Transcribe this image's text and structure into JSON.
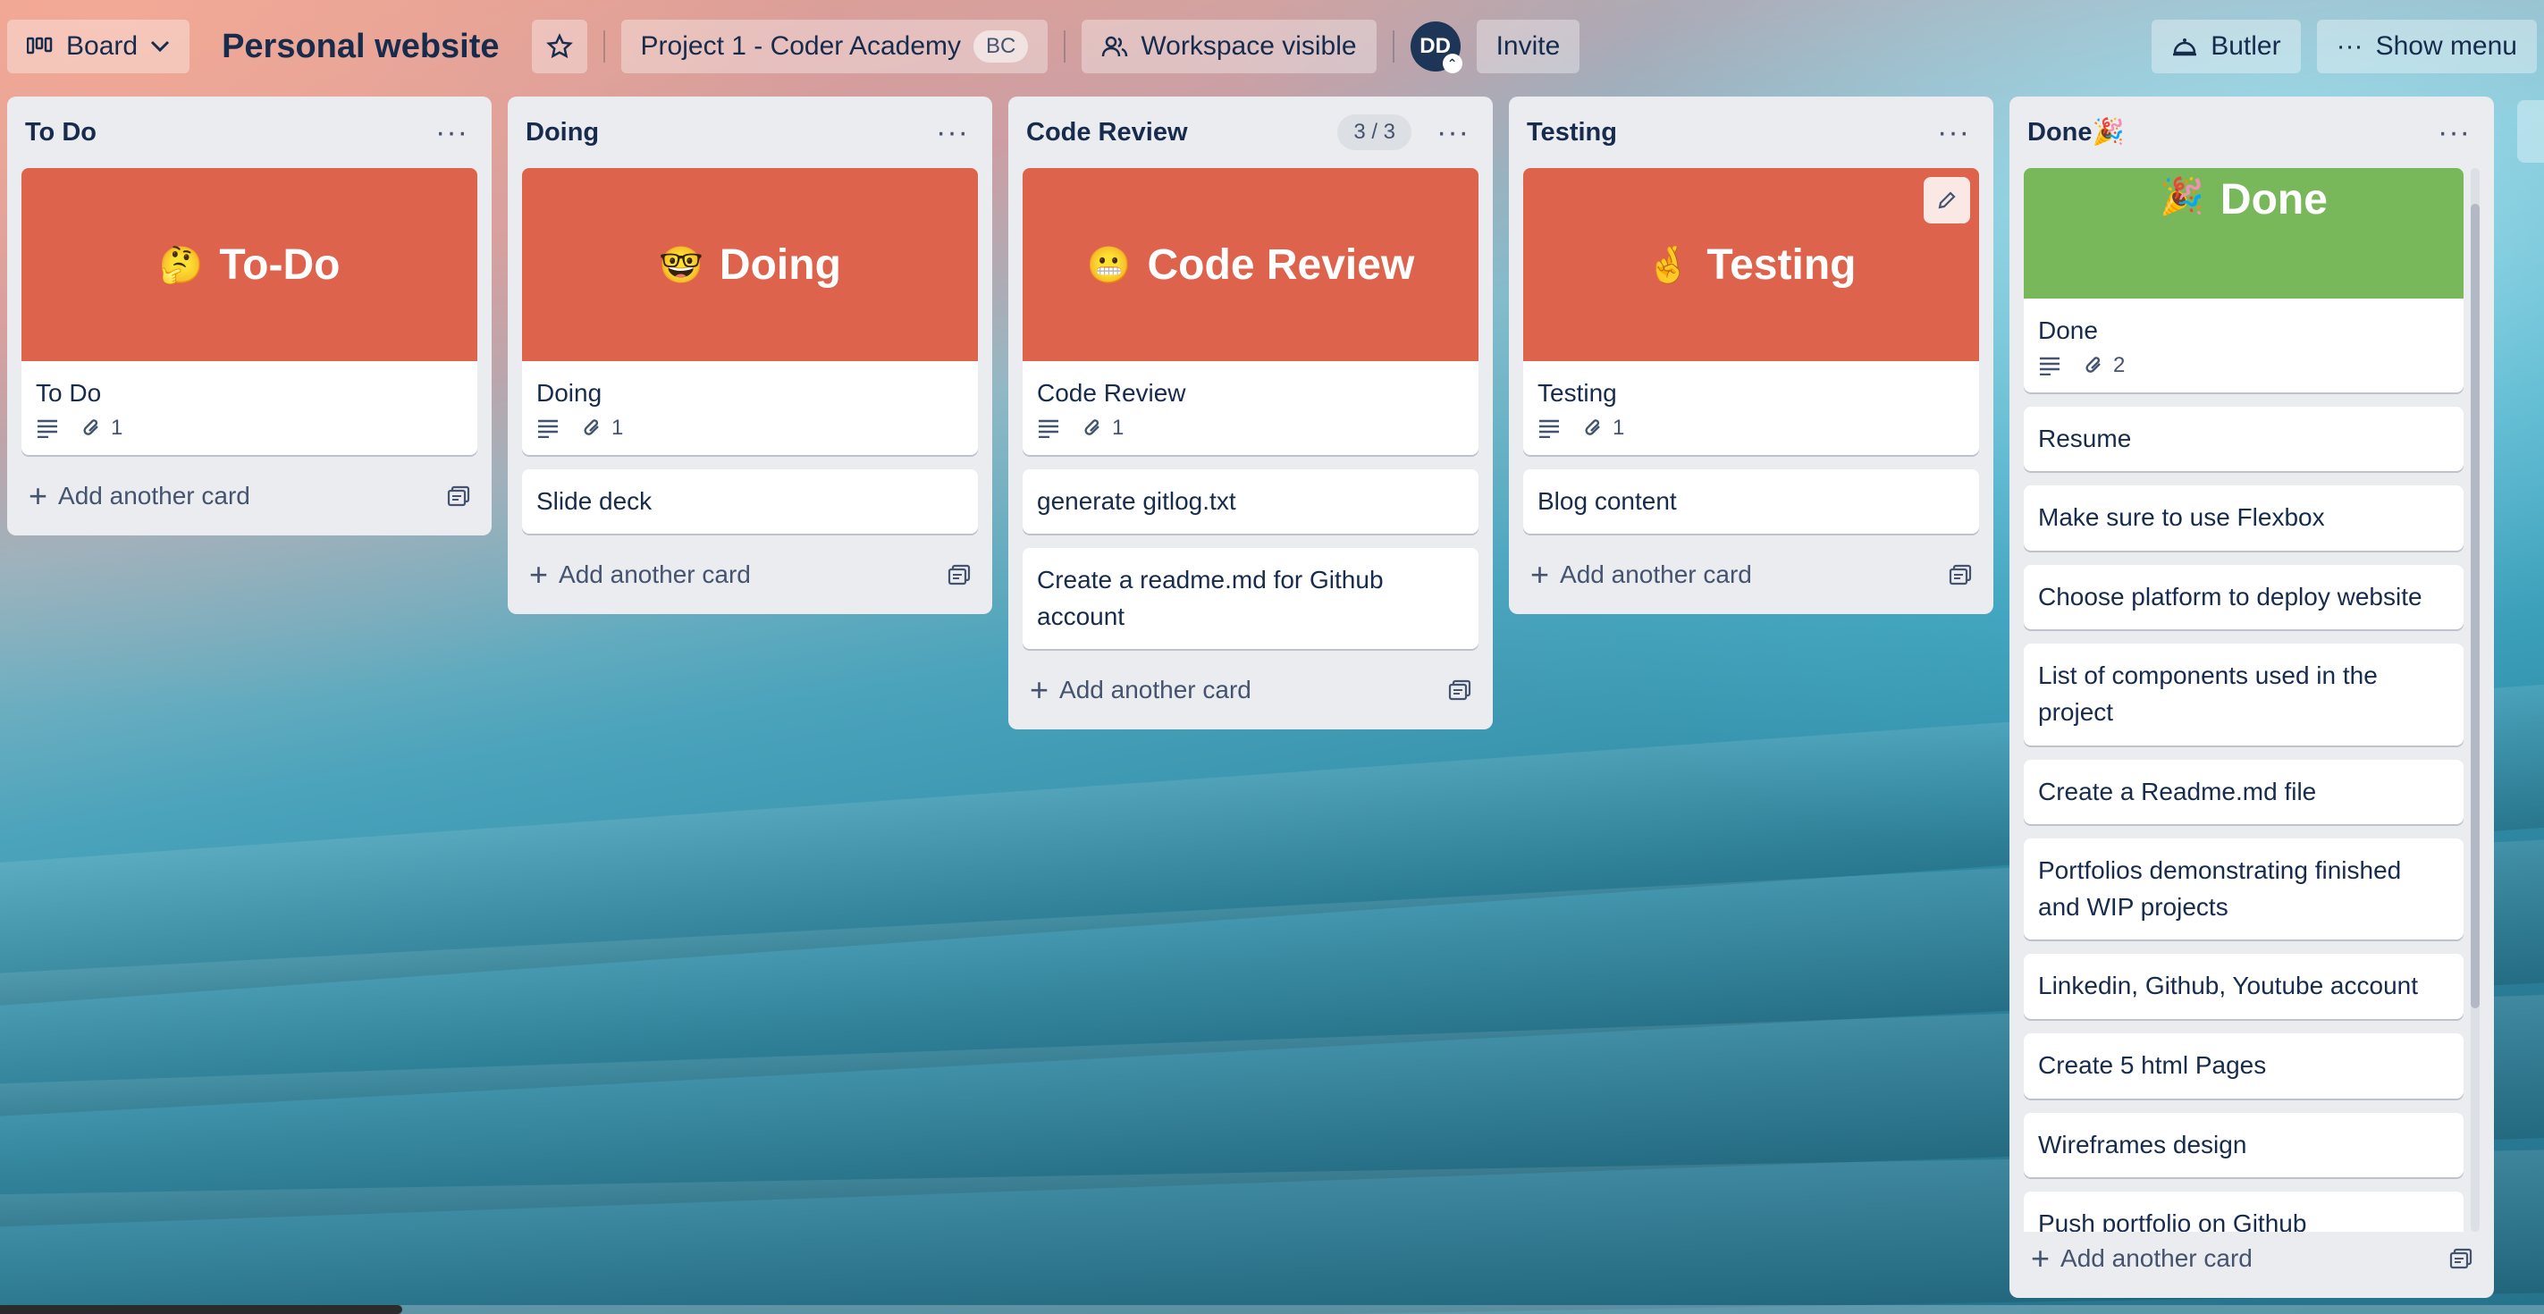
{
  "header": {
    "view_label": "Board",
    "board_title": "Personal website",
    "workspace_label": "Project 1 - Coder Academy",
    "workspace_badge": "BC",
    "visibility_label": "Workspace visible",
    "avatar_initials": "DD",
    "invite_label": "Invite",
    "butler_label": "Butler",
    "menu_label": "Show menu"
  },
  "lists": [
    {
      "title": "To Do",
      "cover": {
        "emoji": "🤔",
        "text": "To-Do",
        "color": "#de634d"
      },
      "first_card": {
        "title": "To Do",
        "attachments": "1"
      },
      "add_label": "Add another card"
    },
    {
      "title": "Doing",
      "cover": {
        "emoji": "🤓",
        "text": "Doing",
        "color": "#de634d"
      },
      "first_card": {
        "title": "Doing",
        "attachments": "1"
      },
      "cards": [
        "Slide deck"
      ],
      "add_label": "Add another card"
    },
    {
      "title": "Code Review",
      "count": "3 / 3",
      "cover": {
        "emoji": "😬",
        "text": "Code Review",
        "color": "#de634d"
      },
      "first_card": {
        "title": "Code Review",
        "attachments": "1"
      },
      "cards": [
        "generate gitlog.txt",
        "Create a readme.md for Github account"
      ],
      "add_label": "Add another card"
    },
    {
      "title": "Testing",
      "cover": {
        "emoji": "🤞",
        "text": "Testing",
        "color": "#de634d"
      },
      "first_card": {
        "title": "Testing",
        "attachments": "1"
      },
      "cards": [
        "Blog content"
      ],
      "add_label": "Add another card"
    },
    {
      "title": "Done🎉",
      "cover": {
        "emoji": "🎉",
        "text": "Done",
        "color": "#78b85a"
      },
      "first_card": {
        "title": "Done",
        "attachments": "2"
      },
      "cards": [
        "Resume",
        "Make sure to use Flexbox",
        "Choose platform to deploy website",
        "List of components used in the project",
        "Create a Readme.md file",
        "Portfolios demonstrating finished and WIP projects",
        "Linkedin, Github, Youtube account",
        "Create 5 html Pages",
        "Wireframes design",
        "Push portfolio on Github"
      ],
      "add_label": "Add another card"
    }
  ]
}
